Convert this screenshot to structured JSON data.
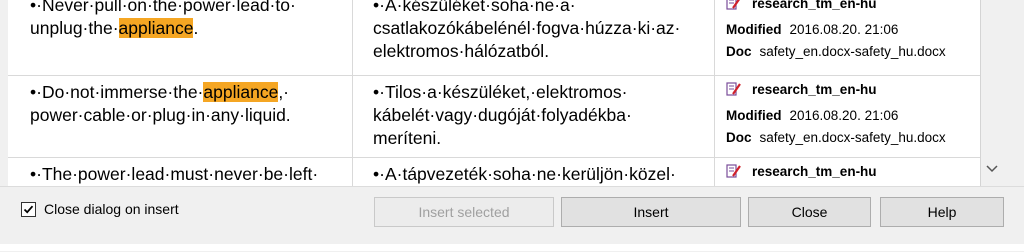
{
  "results": [
    {
      "source_lines": [
        [
          {
            "t": "•·Never·pull·on·the·power·lead·to·"
          }
        ],
        [
          {
            "t": "unplug·the·"
          },
          {
            "t": "appliance",
            "hl": true
          },
          {
            "t": "."
          }
        ]
      ],
      "target_lines": [
        "•·A·készüléket·soha·ne·a·",
        "csatlakozókábelénél·fogva·húzza·ki·az·",
        "elektromos·hálózatból."
      ],
      "tm_name": "research_tm_en-hu",
      "modified_label": "Modified",
      "modified_value": "2016.08.20. 21:06",
      "doc_label": "Doc",
      "doc_value": "safety_en.docx-safety_hu.docx"
    },
    {
      "source_lines": [
        [
          {
            "t": "•·Do·not·immerse·the·"
          },
          {
            "t": "appliance",
            "hl": true
          },
          {
            "t": ",·"
          }
        ],
        [
          {
            "t": "power·cable·or·plug·in·any·liquid."
          }
        ]
      ],
      "target_lines": [
        "•·Tilos·a·készüléket,·elektromos·",
        "kábelét·vagy·dugóját·folyadékba·",
        "meríteni."
      ],
      "tm_name": "research_tm_en-hu",
      "modified_label": "Modified",
      "modified_value": "2016.08.20. 21:06",
      "doc_label": "Doc",
      "doc_value": "safety_en.docx-safety_hu.docx"
    },
    {
      "source_lines": [
        [
          {
            "t": "•·The·power·lead·must·never·be·left·"
          }
        ]
      ],
      "target_lines": [
        "•·A·tápvezeték·soha·ne·kerüljön·közel·"
      ],
      "tm_name": "research_tm_en-hu"
    }
  ],
  "bottom": {
    "checkbox_label": "Close dialog on insert",
    "checkbox_checked": true,
    "insert_selected_label": "Insert selected",
    "insert_label": "Insert",
    "close_label": "Close",
    "help_label": "Help"
  },
  "icons": {
    "tm": "tm-document-icon",
    "scroll_down": "chevron-down-icon"
  },
  "colors": {
    "highlight": "#f5a623"
  }
}
